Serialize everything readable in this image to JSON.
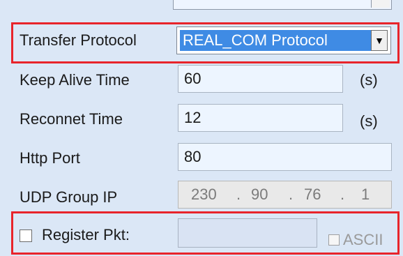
{
  "fields": {
    "transfer_protocol": {
      "label": "Transfer Protocol",
      "value": "REAL_COM Protocol"
    },
    "keep_alive": {
      "label": "Keep Alive Time",
      "value": "60",
      "unit": "(s)"
    },
    "reconnect": {
      "label": "Reconnet Time",
      "value": "12",
      "unit": "(s)"
    },
    "http_port": {
      "label": "Http Port",
      "value": "80"
    },
    "udp_group_ip": {
      "label": "UDP Group IP",
      "octets": [
        "230",
        "90",
        "76",
        "1"
      ],
      "separator": "."
    },
    "register_pkt": {
      "label": "Register Pkt:",
      "value": "",
      "ascii_label": "ASCII"
    }
  },
  "colors": {
    "panel_bg": "#dbe7f6",
    "highlight_red": "#e8242b",
    "selection_blue": "#3f8be4",
    "input_bg": "#edf5ff",
    "disabled_text": "#7b7b7b"
  },
  "icons": {
    "dropdown": "triangle-down"
  }
}
